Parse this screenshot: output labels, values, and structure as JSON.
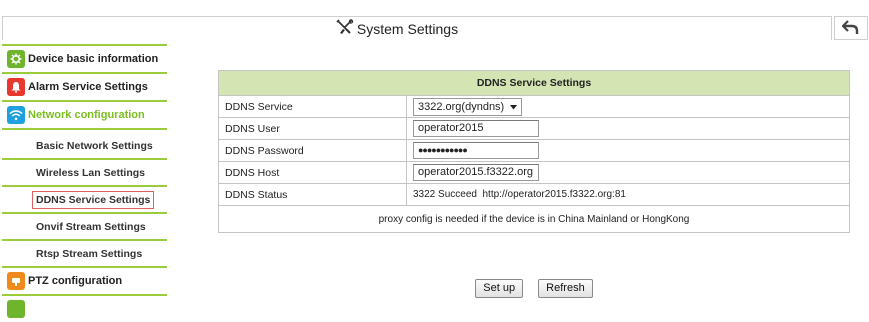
{
  "header": {
    "title": "System Settings",
    "title_icon": "tools-icon",
    "back_icon": "back-arrow-icon"
  },
  "sidebar": {
    "items": [
      {
        "label": "Device basic information",
        "icon": "gear-icon",
        "color": "#6fb52c"
      },
      {
        "label": "Alarm Service Settings",
        "icon": "bell-icon",
        "color": "#e8392e"
      },
      {
        "label": "Network configuration",
        "icon": "wifi-icon",
        "color": "#1ea0e0"
      },
      {
        "label": "PTZ configuration",
        "icon": "ptz-icon",
        "color": "#f08a1c"
      }
    ],
    "sub_items": [
      {
        "label": "Basic Network Settings"
      },
      {
        "label": "Wireless Lan Settings"
      },
      {
        "label": "DDNS Service Settings",
        "active": true
      },
      {
        "label": "Onvif Stream Settings"
      },
      {
        "label": "Rtsp Stream Settings"
      }
    ]
  },
  "ddns": {
    "section_title": "DDNS Service Settings",
    "service_label": "DDNS Service",
    "service_value": "3322.org(dyndns)",
    "user_label": "DDNS User",
    "user_value": "operator2015",
    "password_label": "DDNS Password",
    "password_value": "●●●●●●●●●●●",
    "host_label": "DDNS Host",
    "host_value": "operator2015.f3322.org",
    "status_label": "DDNS Status",
    "status_value": "3322 Succeed  http://operator2015.f3322.org:81",
    "note": "proxy config is needed if the device is in China Mainland or HongKong"
  },
  "buttons": {
    "setup": "Set up",
    "refresh": "Refresh"
  },
  "colors": {
    "accent_green": "#9ccc3c",
    "table_header_bg": "#d4e5b3",
    "network_label": "#7bbf1e",
    "active_border": "#e06060"
  }
}
